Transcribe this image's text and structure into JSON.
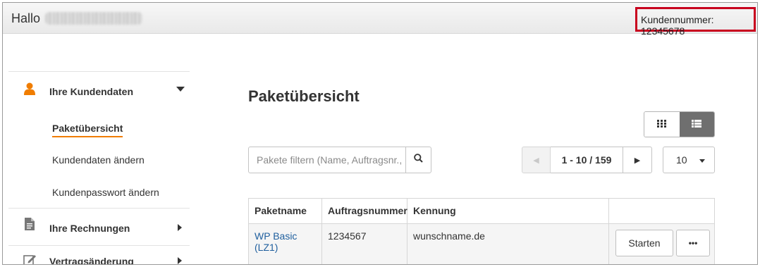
{
  "header": {
    "greeting": "Hallo",
    "customer_number": "Kundennummer: 12345678",
    "highlight_color": "#c8001e"
  },
  "sidebar": {
    "sections": [
      {
        "label": "Ihre Kundendaten",
        "icon": "user-icon",
        "expanded": true,
        "accent": "#f07d00",
        "items": [
          {
            "label": "Paketübersicht",
            "active": true
          },
          {
            "label": "Kundendaten ändern"
          },
          {
            "label": "Kundenpasswort ändern"
          }
        ]
      },
      {
        "label": "Ihre Rechnungen",
        "icon": "document-icon",
        "expanded": false
      },
      {
        "label": "Vertragsänderung",
        "icon": "edit-icon",
        "expanded": false
      }
    ]
  },
  "main": {
    "title": "Paketübersicht",
    "view_modes": [
      "grid-view-icon",
      "list-view-icon"
    ],
    "active_view": "list",
    "filter": {
      "placeholder": "Pakete filtern (Name, Auftragsnr., Kennung)"
    },
    "pagination": {
      "range": "1 - 10 / 159",
      "per_page": "10"
    },
    "table": {
      "columns": [
        "Paketname",
        "Auftragsnummer",
        "Kennung",
        ""
      ],
      "rows": [
        {
          "paketname": "WP Basic (LZ1)",
          "auftragsnummer": "1234567",
          "kennung": "wunschname.de",
          "start_label": "Starten",
          "more_label": "•••"
        }
      ]
    }
  }
}
